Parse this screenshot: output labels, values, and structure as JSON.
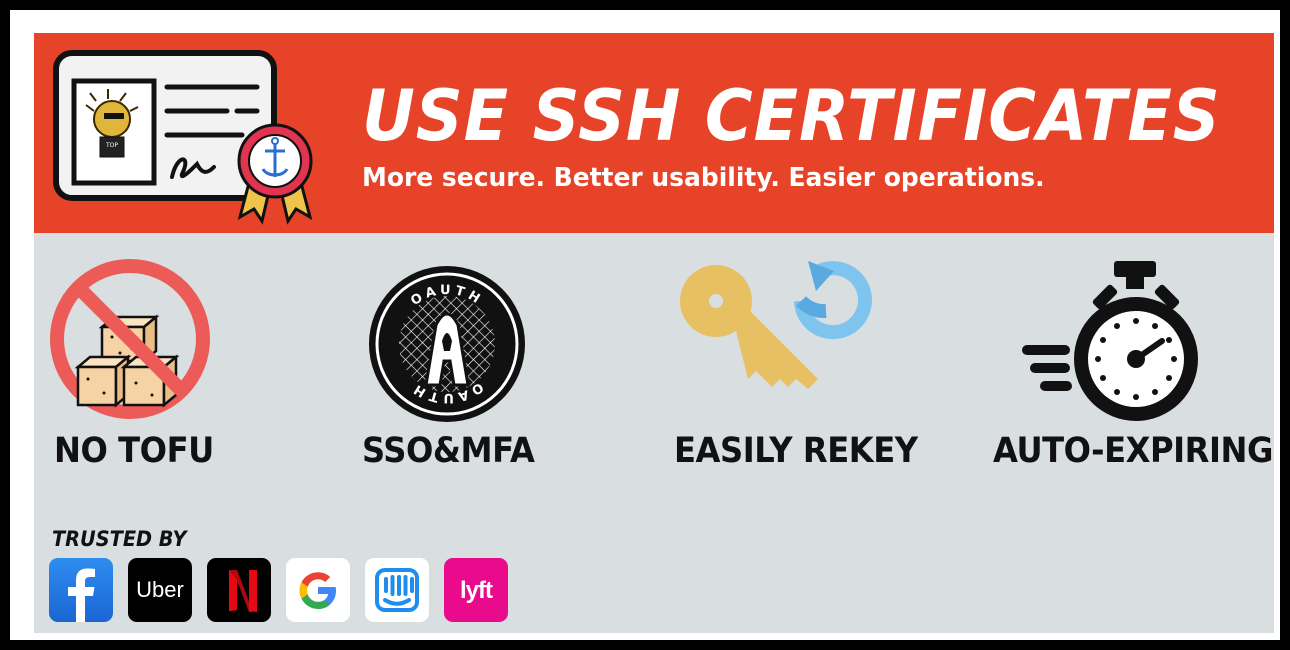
{
  "banner": {
    "title": "USE SSH CERTIFICATES",
    "subtitle": "More secure. Better usability. Easier operations."
  },
  "features": [
    {
      "label": "NO TOFU",
      "icon": "no-tofu-icon"
    },
    {
      "label": "SSO&MFA",
      "icon": "oauth-icon"
    },
    {
      "label": "EASILY REKEY",
      "icon": "key-refresh-icon"
    },
    {
      "label": "AUTO-EXPIRING",
      "icon": "stopwatch-icon"
    }
  ],
  "oauth_badge_text": "OAUTH",
  "trusted": {
    "heading": "TRUSTED BY",
    "logos": [
      {
        "name": "facebook-logo",
        "text": "f"
      },
      {
        "name": "uber-logo",
        "text": "Uber"
      },
      {
        "name": "netflix-logo",
        "text": "N"
      },
      {
        "name": "google-logo",
        "text": "G"
      },
      {
        "name": "intercom-logo",
        "text": ""
      },
      {
        "name": "lyft-logo",
        "text": "lyft"
      }
    ]
  },
  "colors": {
    "banner": "#e64328",
    "background": "#d9dee0",
    "no_sign": "#ec5b57",
    "key": "#e7c063",
    "refresh": "#7fc4ef"
  }
}
